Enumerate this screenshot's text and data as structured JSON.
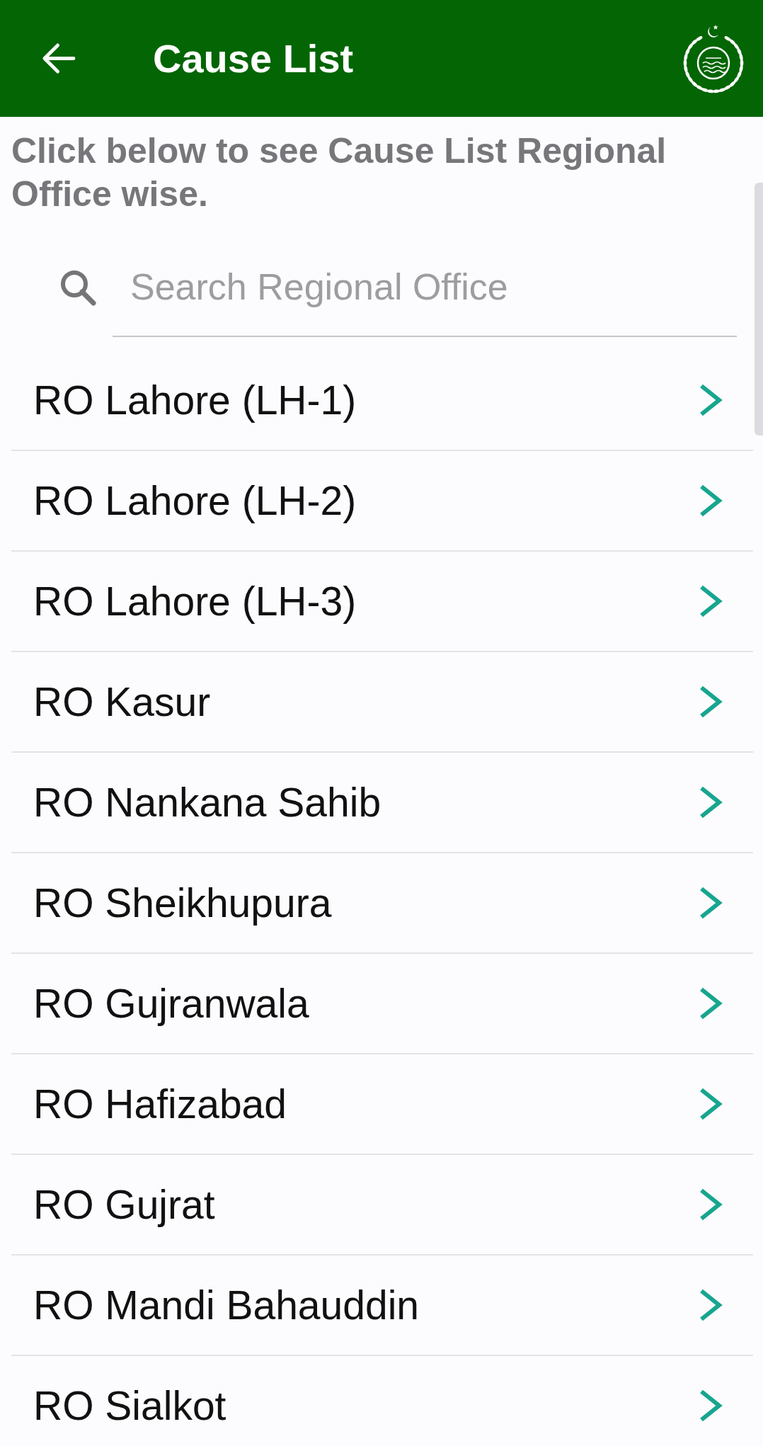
{
  "app_bar": {
    "title": "Cause List"
  },
  "intro": "Click below to see Cause List Regional Office wise.",
  "search": {
    "placeholder": "Search Regional Office"
  },
  "offices": [
    "RO Lahore (LH-1)",
    "RO Lahore (LH-2)",
    "RO Lahore (LH-3)",
    "RO Kasur",
    "RO Nankana Sahib",
    "RO Sheikhupura",
    "RO Gujranwala",
    "RO Hafizabad",
    "RO Gujrat",
    "RO Mandi Bahauddin",
    "RO Sialkot"
  ]
}
